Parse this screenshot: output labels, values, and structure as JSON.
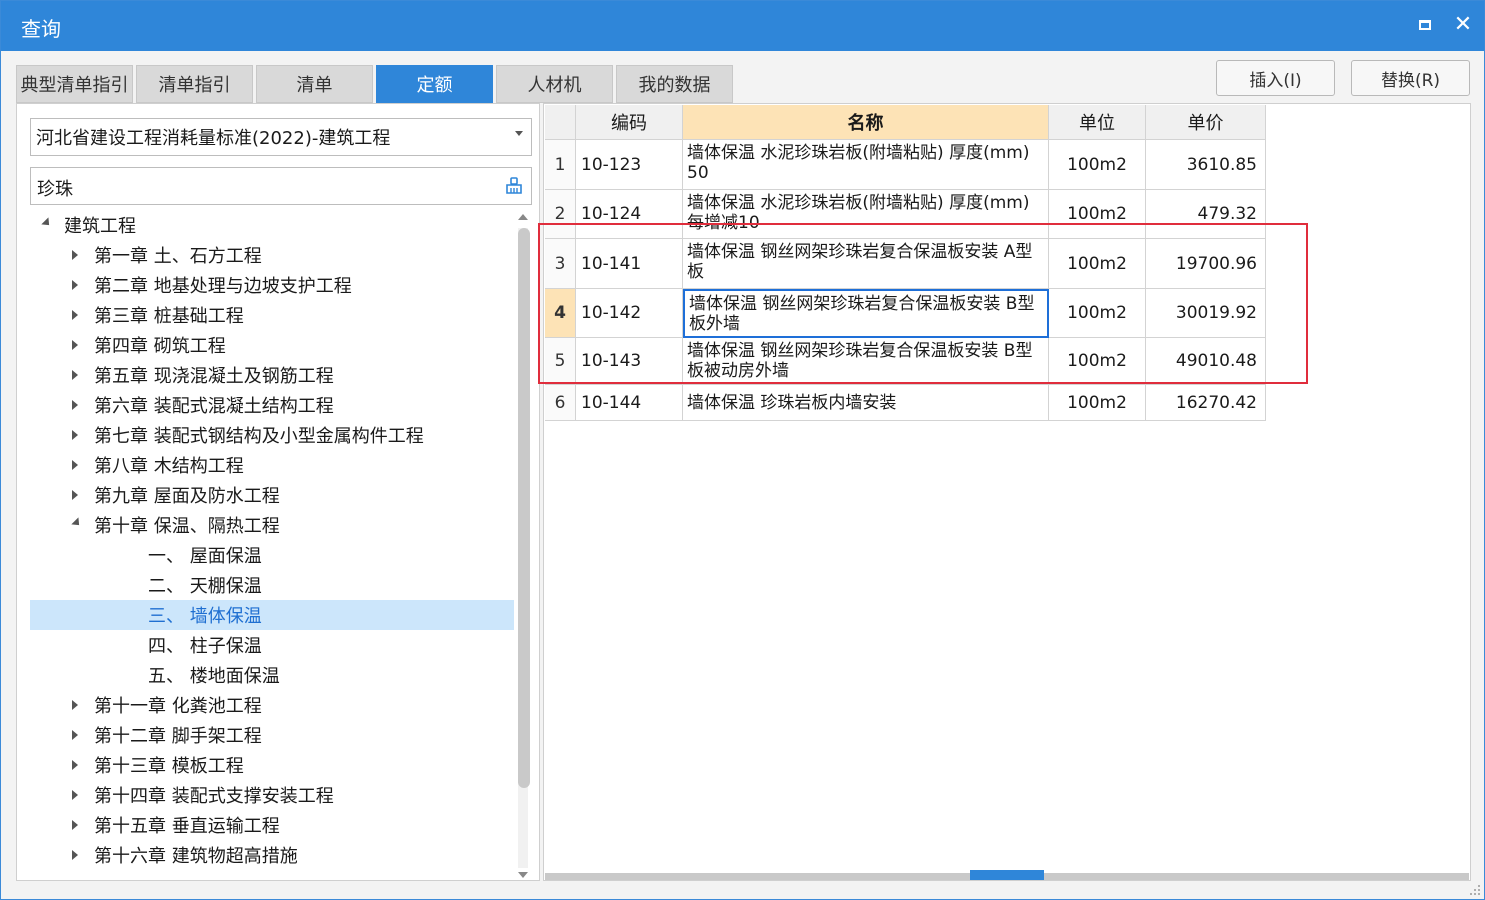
{
  "window": {
    "title": "查询"
  },
  "tabs": [
    {
      "label": "典型清单指引",
      "active": false
    },
    {
      "label": "清单指引",
      "active": false
    },
    {
      "label": "清单",
      "active": false
    },
    {
      "label": "定额",
      "active": true
    },
    {
      "label": "人材机",
      "active": false
    },
    {
      "label": "我的数据",
      "active": false
    }
  ],
  "actions": {
    "insert_label": "插入(I)",
    "replace_label": "替换(R)"
  },
  "left": {
    "library_select": "河北省建设工程消耗量标准(2022)-建筑工程",
    "search_value": "珍珠",
    "tree": [
      {
        "label": "建筑工程",
        "level": 0,
        "expanded": true
      },
      {
        "label": "第一章 土、石方工程",
        "level": 1,
        "expanded": false
      },
      {
        "label": "第二章 地基处理与边坡支护工程",
        "level": 1,
        "expanded": false
      },
      {
        "label": "第三章 桩基础工程",
        "level": 1,
        "expanded": false
      },
      {
        "label": "第四章 砌筑工程",
        "level": 1,
        "expanded": false
      },
      {
        "label": "第五章 现浇混凝土及钢筋工程",
        "level": 1,
        "expanded": false
      },
      {
        "label": "第六章 装配式混凝土结构工程",
        "level": 1,
        "expanded": false
      },
      {
        "label": "第七章 装配式钢结构及小型金属构件工程",
        "level": 1,
        "expanded": false
      },
      {
        "label": "第八章 木结构工程",
        "level": 1,
        "expanded": false
      },
      {
        "label": "第九章 屋面及防水工程",
        "level": 1,
        "expanded": false
      },
      {
        "label": "第十章 保温、隔热工程",
        "level": 1,
        "expanded": true
      },
      {
        "label": "一、 屋面保温",
        "level": 2
      },
      {
        "label": "二、 天棚保温",
        "level": 2
      },
      {
        "label": "三、 墙体保温",
        "level": 2,
        "selected": true
      },
      {
        "label": "四、 柱子保温",
        "level": 2
      },
      {
        "label": "五、 楼地面保温",
        "level": 2
      },
      {
        "label": "第十一章 化粪池工程",
        "level": 1,
        "expanded": false
      },
      {
        "label": "第十二章 脚手架工程",
        "level": 1,
        "expanded": false
      },
      {
        "label": "第十三章 模板工程",
        "level": 1,
        "expanded": false
      },
      {
        "label": "第十四章 装配式支撑安装工程",
        "level": 1,
        "expanded": false
      },
      {
        "label": "第十五章 垂直运输工程",
        "level": 1,
        "expanded": false
      },
      {
        "label": "第十六章 建筑物超高措施",
        "level": 1,
        "expanded": false
      }
    ]
  },
  "grid": {
    "columns": [
      "编码",
      "名称",
      "单位",
      "单价"
    ],
    "rows": [
      {
        "no": "1",
        "code": "10-123",
        "name": "墙体保温 水泥珍珠岩板(附墙粘贴) 厚度(mm) 50",
        "unit": "100m2",
        "price": "3610.85"
      },
      {
        "no": "2",
        "code": "10-124",
        "name": "墙体保温 水泥珍珠岩板(附墙粘贴) 厚度(mm) 每增减10",
        "unit": "100m2",
        "price": "479.32"
      },
      {
        "no": "3",
        "code": "10-141",
        "name": "墙体保温 钢丝网架珍珠岩复合保温板安装 A型板",
        "unit": "100m2",
        "price": "19700.96"
      },
      {
        "no": "4",
        "code": "10-142",
        "name": "墙体保温 钢丝网架珍珠岩复合保温板安装 B型板外墙",
        "unit": "100m2",
        "price": "30019.92",
        "current": true
      },
      {
        "no": "5",
        "code": "10-143",
        "name": "墙体保温 钢丝网架珍珠岩复合保温板安装 B型板被动房外墙",
        "unit": "100m2",
        "price": "49010.48"
      },
      {
        "no": "6",
        "code": "10-144",
        "name": "墙体保温 珍珠岩板内墙安装",
        "unit": "100m2",
        "price": "16270.42"
      }
    ]
  },
  "colors": {
    "accent": "#2f86d9",
    "highlight": "#e02d3c",
    "header_active": "#fde3b6",
    "selected_tree": "#cce6fb"
  }
}
